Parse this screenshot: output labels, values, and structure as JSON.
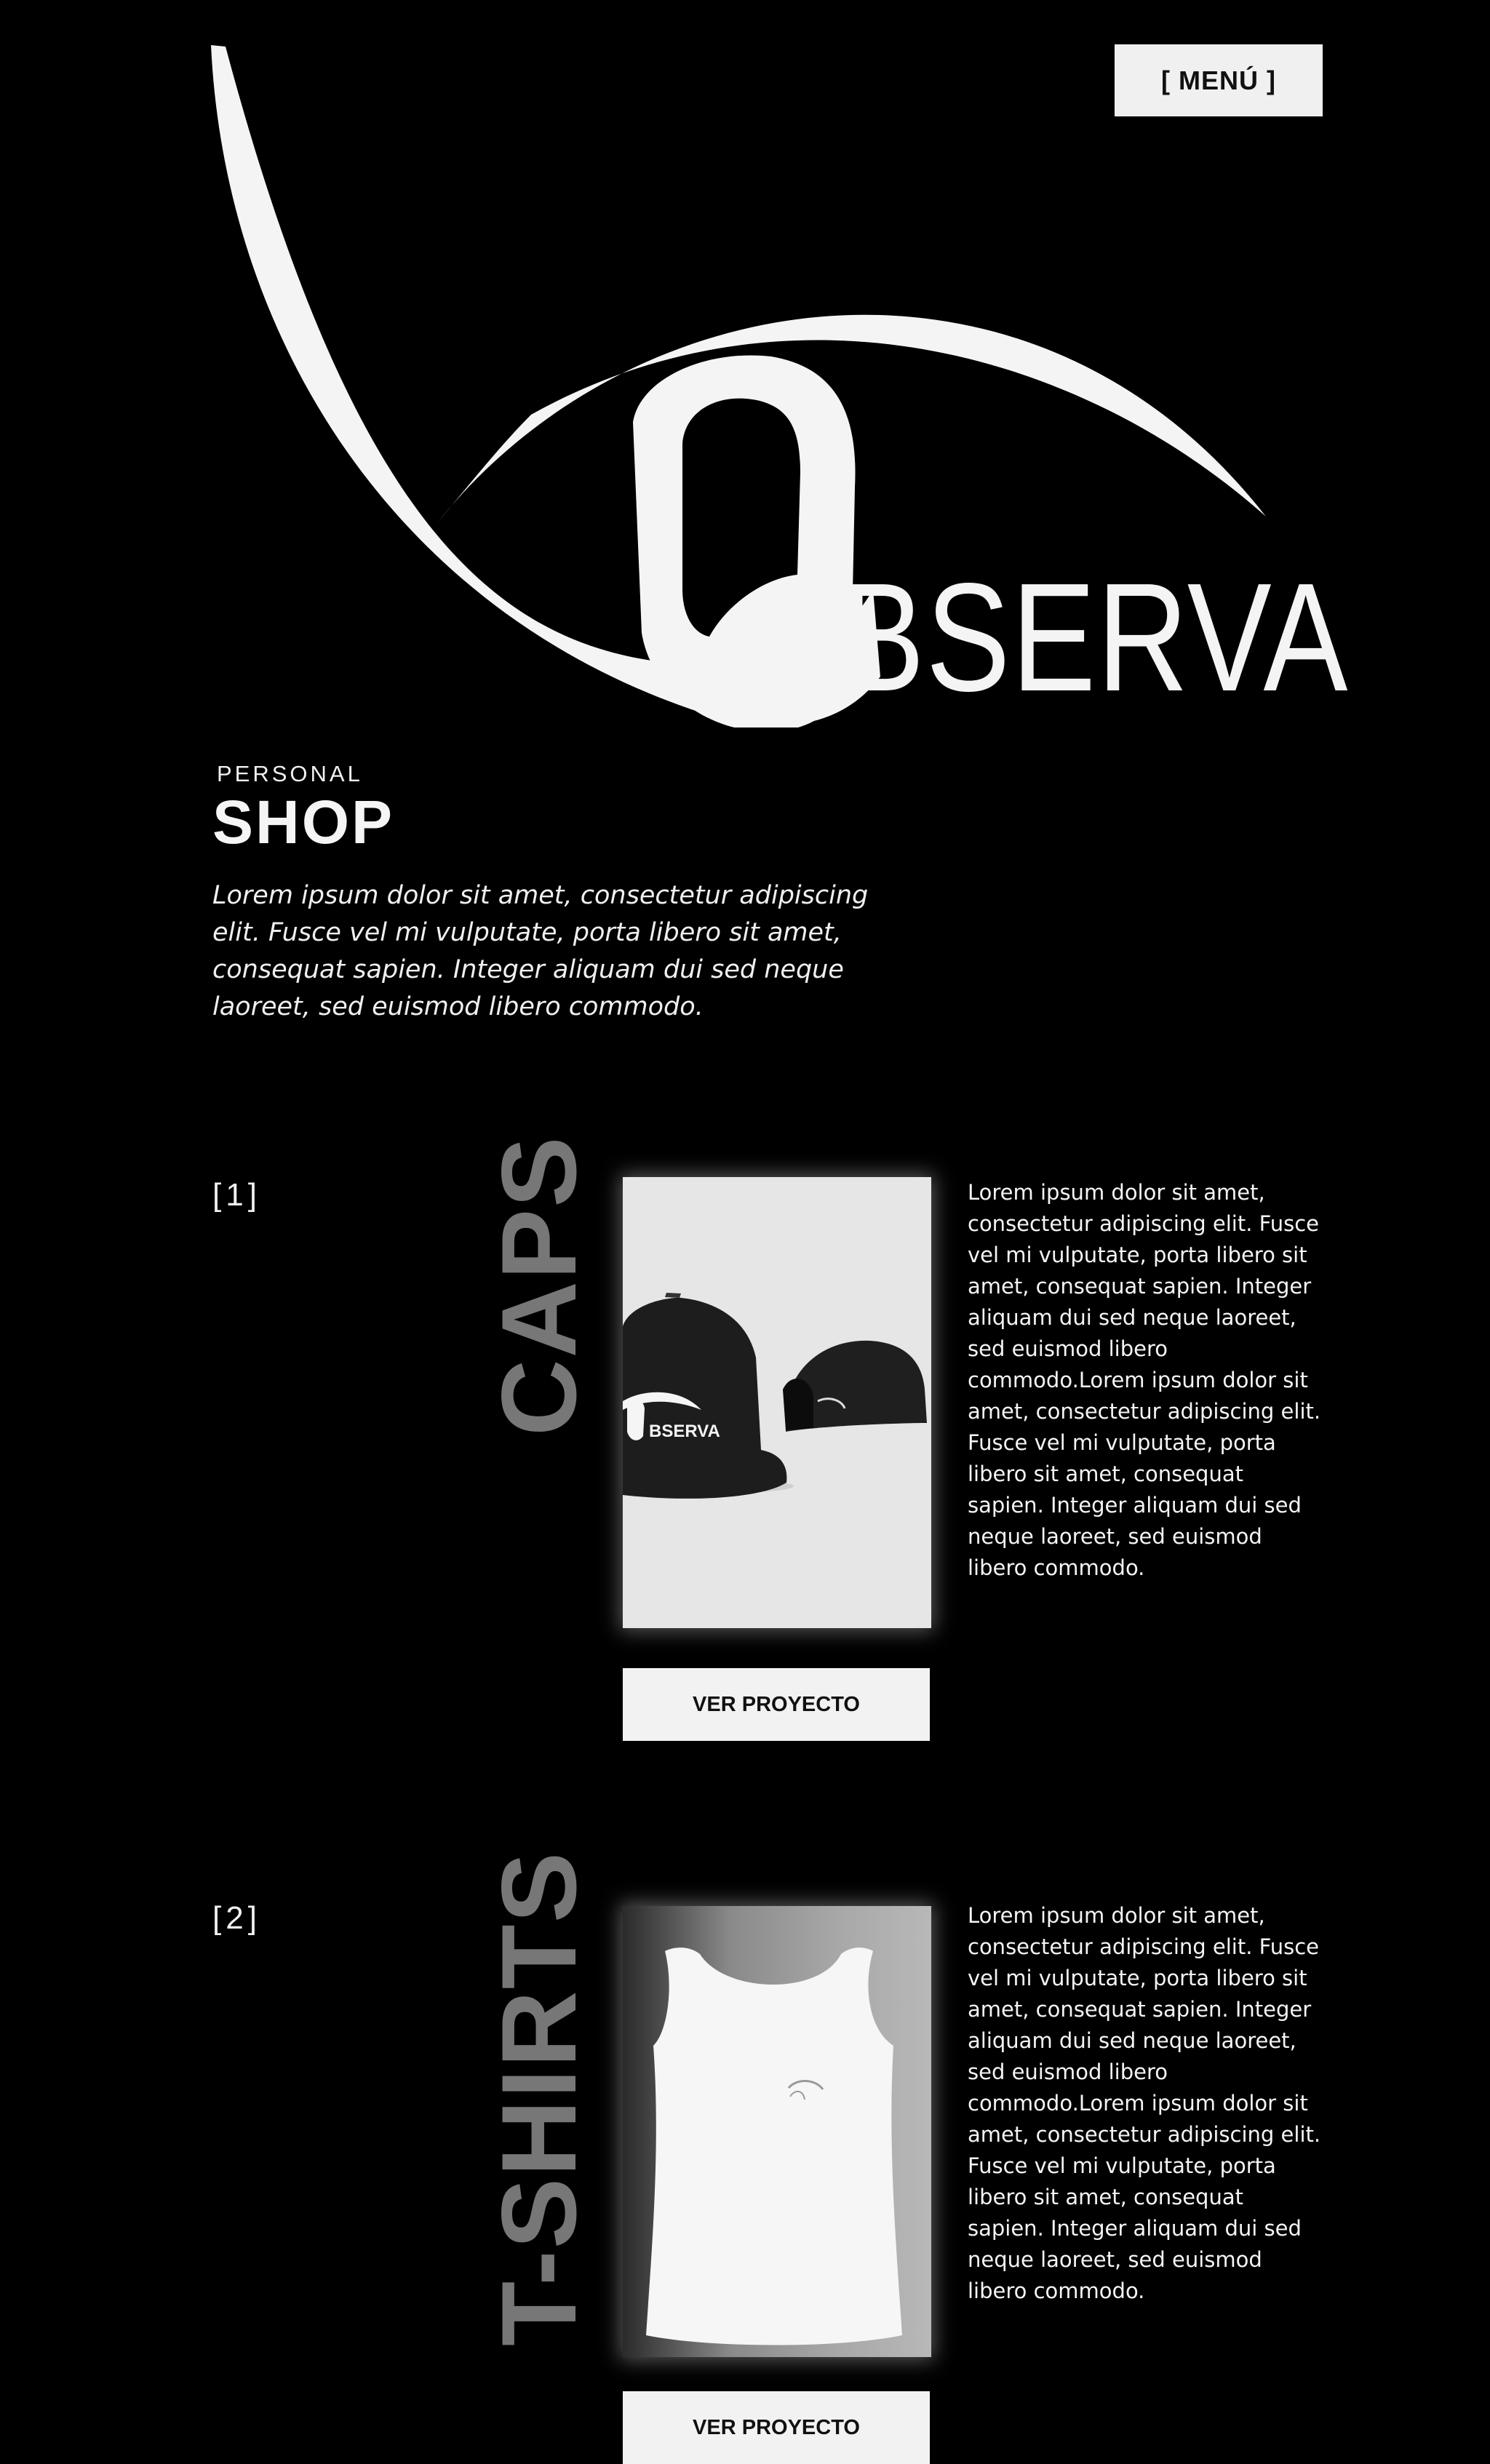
{
  "header": {
    "menu_label": "[ MENÚ ]"
  },
  "hero": {
    "logo_word": "BSERVA",
    "kicker": "PERSONAL",
    "title": "SHOP",
    "intro": "Lorem ipsum dolor sit amet, consectetur adipiscing elit. Fusce vel mi vulputate, porta libero sit amet, consequat sapien. Integer aliquam dui sed neque laoreet, sed euismod libero commodo."
  },
  "sections": [
    {
      "number": "[1]",
      "title": "CAPS",
      "description": "Lorem ipsum dolor sit amet, consectetur adipiscing elit. Fusce vel mi vulputate, porta libero sit amet, consequat sapien. Integer aliquam dui sed neque laoreet, sed euismod libero commodo.Lorem ipsum dolor sit amet, consectetur adipiscing elit. Fusce vel mi vulputate, porta libero sit amet, consequat sapien. Integer aliquam dui sed neque laoreet, sed euismod libero commodo.",
      "button_label": "VER PROYECTO",
      "image_brand": "BSERVA"
    },
    {
      "number": "[2]",
      "title": "T-SHIRTS",
      "description": "Lorem ipsum dolor sit amet, consectetur adipiscing elit. Fusce vel mi vulputate, porta libero sit amet, consequat sapien. Integer aliquam dui sed neque laoreet, sed euismod libero commodo.Lorem ipsum dolor sit amet, consectetur adipiscing elit. Fusce vel mi vulputate, porta libero sit amet, consequat sapien. Integer aliquam dui sed neque laoreet, sed euismod libero commodo.",
      "button_label": "VER PROYECTO"
    }
  ],
  "colors": {
    "background": "#000000",
    "foreground": "#f2f2f2",
    "muted_title": "#777777"
  },
  "icons": [
    "observa-eye-logo-icon",
    "cap-product-icon",
    "tank-top-product-icon"
  ]
}
